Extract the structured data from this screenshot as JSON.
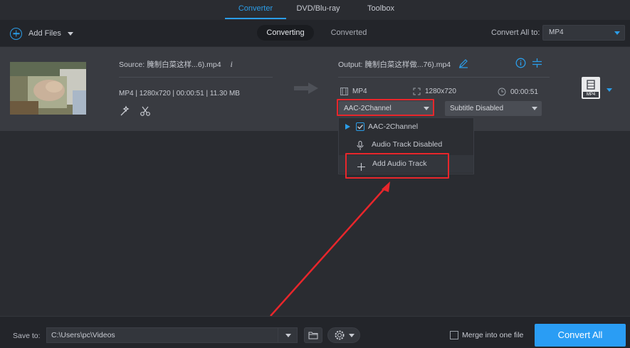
{
  "nav": {
    "tabs": [
      "Converter",
      "DVD/Blu-ray",
      "Toolbox"
    ],
    "active": "Converter"
  },
  "toolbar": {
    "add_files": "Add Files",
    "converting": "Converting",
    "converted": "Converted",
    "convert_all_to": "Convert All to:",
    "format": "MP4"
  },
  "file": {
    "source_label": "Source: 腌制白菜这样...6).mp4",
    "source_meta": "MP4 | 1280x720 | 00:00:51 | 11.30 MB",
    "output_label": "Output: 腌制白菜这样做...76).mp4",
    "output_format": "MP4",
    "output_resolution": "1280x720",
    "output_duration": "00:00:51",
    "audio_select": "AAC-2Channel",
    "subtitle_select": "Subtitle Disabled",
    "badge": "MP4"
  },
  "audio_menu": {
    "items": [
      "AAC-2Channel",
      "Audio Track Disabled",
      "Add Audio Track"
    ]
  },
  "bottom": {
    "save_to": "Save to:",
    "path": "C:\\Users\\pc\\Videos",
    "merge": "Merge into one file",
    "convert_all": "Convert All"
  },
  "colors": {
    "accent": "#2b9de8",
    "highlight": "#e8262b",
    "convert_button": "#2a9df4"
  }
}
